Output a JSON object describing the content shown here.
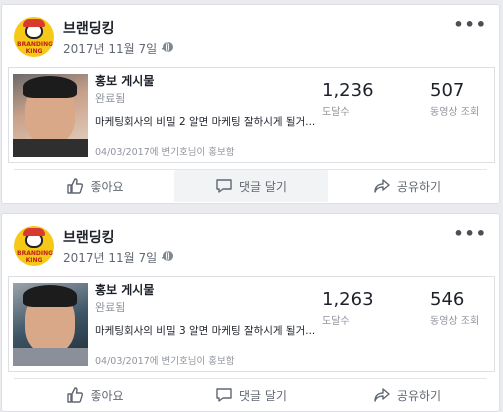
{
  "posts": [
    {
      "page_name": "브랜딩킹",
      "date": "2017년 11월 7일 ·",
      "more_label": "•••",
      "avatar_text": "BRANDING KING",
      "promo": {
        "title": "홍보 게시물",
        "status": "완료됨",
        "caption": "마케팅회사의 비밀 2 알면 마케팅 잘하시게 될거...",
        "footer": "04/03/2017에 변기호님이 홍보함",
        "stats": [
          {
            "value": "1,236",
            "label": "도달수"
          },
          {
            "value": "507",
            "label": "동영상 조회"
          }
        ]
      },
      "actions": [
        "좋아요",
        "댓글 달기",
        "공유하기"
      ]
    },
    {
      "page_name": "브랜딩킹",
      "date": "2017년 11월 7일 ·",
      "more_label": "•••",
      "avatar_text": "BRANDING KING",
      "promo": {
        "title": "홍보 게시물",
        "status": "완료됨",
        "caption": "마케팅회사의 비밀 3 알면 마케팅 잘하시게 될거...",
        "footer": "04/03/2017에 변기호님이 홍보함",
        "stats": [
          {
            "value": "1,263",
            "label": "도달수"
          },
          {
            "value": "546",
            "label": "동영상 조회"
          }
        ]
      },
      "actions": [
        "좋아요",
        "댓글 달기",
        "공유하기"
      ]
    }
  ],
  "icons": {
    "like": "thumbs-up-icon",
    "comment": "speech-bubble-icon",
    "share": "share-arrow-icon",
    "privacy": "globe-icon"
  }
}
